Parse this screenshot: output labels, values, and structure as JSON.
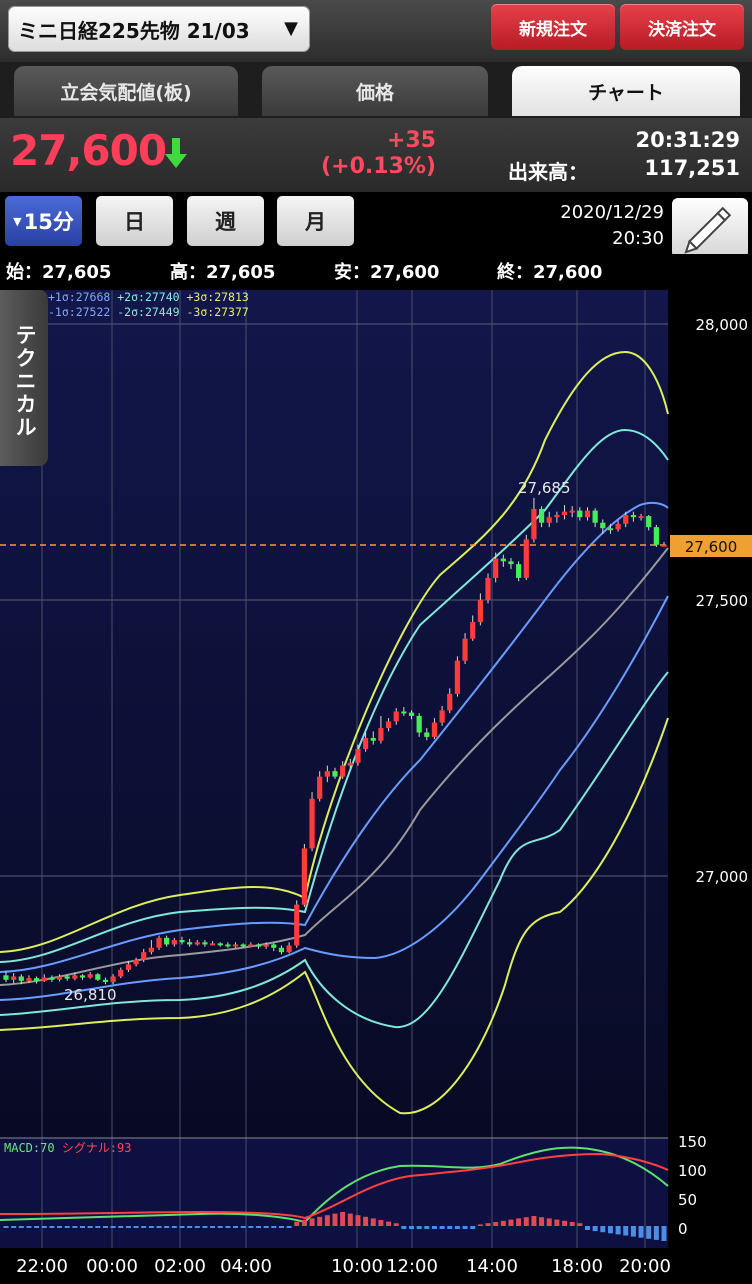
{
  "header": {
    "instrument": "ミニ日経225先物 21/03",
    "new_order": "新規注文",
    "settle_order": "決済注文"
  },
  "tabs": [
    {
      "label": "立会気配値(板)",
      "active": false
    },
    {
      "label": "価格",
      "active": false
    },
    {
      "label": "チャート",
      "active": true
    }
  ],
  "quote": {
    "price": "27,600",
    "change": "+35",
    "change_pct": "(+0.13%)",
    "time": "20:31:29",
    "volume_label": "出来高：",
    "volume": "117,251",
    "direction_icon": "arrow-down-icon"
  },
  "periods": [
    {
      "label": "15分",
      "selected": true
    },
    {
      "label": "日",
      "selected": false
    },
    {
      "label": "週",
      "selected": false
    },
    {
      "label": "月",
      "selected": false
    }
  ],
  "datetime": {
    "date": "2020/12/29",
    "time": "20:30"
  },
  "ohlc": {
    "open": "始：27,605",
    "high": "高：27,605",
    "low": "安：27,600",
    "close": "終：27,600"
  },
  "technical_tab": "テクニカル",
  "bb_legend": {
    "p1": "+1σ:27668",
    "p2": "+2σ:27740",
    "p3": "+3σ:27813",
    "m1": "-1σ:27522",
    "m2": "-2σ:27449",
    "m3": "-3σ:27377"
  },
  "macd_legend": {
    "macd": "MACD:70",
    "signal": "シグナル:93"
  },
  "colors": {
    "accent_red": "#e23440",
    "price_red": "#ff3f5a",
    "up_candle": "#ff3b3b",
    "down_candle": "#44ee55",
    "bb_1sigma": "#6a9cff",
    "bb_2sigma": "#7fe8d8",
    "bb_3sigma": "#dcef5a",
    "ma": "#9a9a9a",
    "current_price_line": "#ff9a2a"
  },
  "chart_data": {
    "type": "candlestick",
    "y_axis_labels": [
      "28,000",
      "27,500",
      "27,000"
    ],
    "y_range": [
      26590,
      28090
    ],
    "current_price_label": "27,600",
    "current_price": 27600,
    "max_label": "27,685",
    "min_label": "26,810",
    "x_labels": [
      "22:00",
      "00:00",
      "02:00",
      "04:00",
      "10:00",
      "12:00",
      "14:00",
      "18:00",
      "20:00"
    ],
    "macd_axis_labels": [
      "150",
      "100",
      "50",
      "0"
    ],
    "candles": [
      [
        26820,
        26812,
        26828,
        26808
      ],
      [
        26812,
        26818,
        26824,
        26806
      ],
      [
        26818,
        26810,
        26822,
        26804
      ],
      [
        26810,
        26815,
        26820,
        26806
      ],
      [
        26815,
        26810,
        26818,
        26805
      ],
      [
        26810,
        26816,
        26822,
        26808
      ],
      [
        26816,
        26812,
        26820,
        26808
      ],
      [
        26812,
        26818,
        26822,
        26809
      ],
      [
        26818,
        26814,
        26821,
        26810
      ],
      [
        26814,
        26820,
        26825,
        26811
      ],
      [
        26820,
        26816,
        26822,
        26812
      ],
      [
        26816,
        26822,
        26826,
        26814
      ],
      [
        26822,
        26812,
        26824,
        26810
      ],
      [
        26812,
        26808,
        26816,
        26804
      ],
      [
        26808,
        26818,
        26822,
        26804
      ],
      [
        26818,
        26830,
        26834,
        26815
      ],
      [
        26830,
        26840,
        26846,
        26826
      ],
      [
        26840,
        26848,
        26852,
        26836
      ],
      [
        26848,
        26862,
        26868,
        26844
      ],
      [
        26862,
        26870,
        26884,
        26858
      ],
      [
        26870,
        26888,
        26892,
        26866
      ],
      [
        26888,
        26876,
        26892,
        26872
      ],
      [
        26876,
        26884,
        26888,
        26872
      ],
      [
        26884,
        26880,
        26890,
        26876
      ],
      [
        26880,
        26876,
        26886,
        26872
      ],
      [
        26876,
        26880,
        26884,
        26874
      ],
      [
        26880,
        26876,
        26884,
        26872
      ],
      [
        26876,
        26878,
        26882,
        26874
      ],
      [
        26878,
        26876,
        26880,
        26872
      ],
      [
        26876,
        26874,
        26880,
        26870
      ],
      [
        26874,
        26876,
        26880,
        26870
      ],
      [
        26876,
        26874,
        26878,
        26870
      ],
      [
        26874,
        26876,
        26880,
        26872
      ],
      [
        26876,
        26872,
        26878,
        26868
      ],
      [
        26872,
        26876,
        26880,
        26868
      ],
      [
        26876,
        26870,
        26878,
        26864
      ],
      [
        26870,
        26862,
        26874,
        26858
      ],
      [
        26862,
        26874,
        26880,
        26860
      ],
      [
        26874,
        26948,
        26956,
        26870
      ],
      [
        26948,
        27050,
        27058,
        26944
      ],
      [
        27050,
        27140,
        27152,
        27045
      ],
      [
        27140,
        27180,
        27190,
        27135
      ],
      [
        27180,
        27190,
        27200,
        27170
      ],
      [
        27190,
        27180,
        27196,
        27176
      ],
      [
        27180,
        27200,
        27208,
        27176
      ],
      [
        27200,
        27205,
        27212,
        27196
      ],
      [
        27205,
        27230,
        27238,
        27200
      ],
      [
        27230,
        27250,
        27260,
        27225
      ],
      [
        27250,
        27245,
        27262,
        27238
      ],
      [
        27245,
        27268,
        27290,
        27240
      ],
      [
        27268,
        27280,
        27286,
        27262
      ],
      [
        27280,
        27298,
        27304,
        27274
      ],
      [
        27298,
        27296,
        27306,
        27290
      ],
      [
        27296,
        27290,
        27300,
        27284
      ],
      [
        27290,
        27260,
        27295,
        27252
      ],
      [
        27260,
        27252,
        27268,
        27246
      ],
      [
        27252,
        27278,
        27286,
        27248
      ],
      [
        27278,
        27300,
        27308,
        27272
      ],
      [
        27300,
        27330,
        27340,
        27295
      ],
      [
        27330,
        27390,
        27398,
        27325
      ],
      [
        27390,
        27430,
        27440,
        27384
      ],
      [
        27430,
        27460,
        27472,
        27426
      ],
      [
        27460,
        27500,
        27512,
        27454
      ],
      [
        27500,
        27540,
        27548,
        27494
      ],
      [
        27540,
        27575,
        27586,
        27532
      ],
      [
        27575,
        27570,
        27582,
        27560
      ],
      [
        27570,
        27565,
        27576,
        27556
      ],
      [
        27565,
        27540,
        27570,
        27534
      ],
      [
        27540,
        27610,
        27618,
        27536
      ],
      [
        27610,
        27665,
        27685,
        27604
      ],
      [
        27665,
        27640,
        27670,
        27632
      ],
      [
        27640,
        27650,
        27660,
        27632
      ],
      [
        27650,
        27654,
        27660,
        27640
      ],
      [
        27654,
        27660,
        27672,
        27646
      ],
      [
        27660,
        27662,
        27670,
        27650
      ],
      [
        27662,
        27650,
        27668,
        27644
      ],
      [
        27650,
        27662,
        27668,
        27644
      ],
      [
        27662,
        27640,
        27666,
        27632
      ],
      [
        27640,
        27630,
        27646,
        27620
      ],
      [
        27630,
        27628,
        27638,
        27620
      ],
      [
        27628,
        27638,
        27644,
        27624
      ],
      [
        27638,
        27654,
        27660,
        27632
      ],
      [
        27654,
        27650,
        27660,
        27642
      ],
      [
        27650,
        27652,
        27656,
        27644
      ],
      [
        27652,
        27632,
        27654,
        27626
      ],
      [
        27632,
        27600,
        27636,
        27596
      ],
      [
        27600,
        27600,
        27605,
        27598
      ]
    ]
  }
}
